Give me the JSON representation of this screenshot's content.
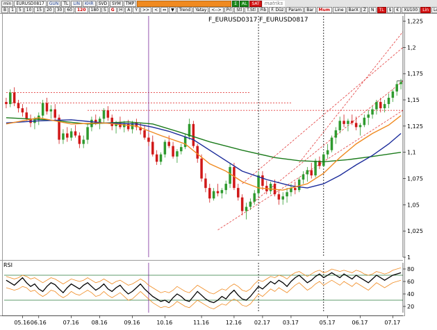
{
  "toolbar": {
    "row1": [
      {
        "label": "min",
        "style": ""
      },
      {
        "label": "EURUSD0817",
        "style": "input"
      },
      {
        "label": "GUN",
        "style": "blue"
      },
      {
        "label": "TL",
        "style": ""
      },
      {
        "label": "LIN",
        "style": "blue"
      },
      {
        "label": "KHR",
        "style": "blue"
      },
      {
        "label": "SVD",
        "style": ""
      },
      {
        "label": "SYM",
        "style": ""
      },
      {
        "label": "TMP",
        "style": ""
      },
      {
        "label": "",
        "style": "orange"
      },
      {
        "label": "Σ",
        "style": "green"
      },
      {
        "label": "AL",
        "style": "green"
      },
      {
        "label": "SAT",
        "style": "red"
      },
      {
        "label": "matriks",
        "style": "brand"
      }
    ],
    "row2": [
      {
        "label": "B",
        "style": ""
      },
      {
        "label": "1",
        "style": ""
      },
      {
        "label": "5",
        "style": ""
      },
      {
        "label": "10",
        "style": ""
      },
      {
        "label": "15",
        "style": ""
      },
      {
        "label": "20",
        "style": ""
      },
      {
        "label": "30",
        "style": ""
      },
      {
        "label": "60",
        "style": ""
      },
      {
        "label": "120",
        "style": "active"
      },
      {
        "label": "180",
        "style": ""
      },
      {
        "label": "S",
        "style": ""
      },
      {
        "label": "G",
        "style": "active"
      },
      {
        "label": "H",
        "style": ""
      },
      {
        "label": "A",
        "style": ""
      },
      {
        "label": "Y",
        "style": ""
      },
      {
        "label": ">>",
        "style": ""
      },
      {
        "label": "<",
        "style": ""
      },
      {
        "label": "⇔",
        "style": ""
      },
      {
        "label": "▼",
        "style": ""
      },
      {
        "label": "Trend",
        "style": ""
      },
      {
        "label": "Yatay",
        "style": ""
      },
      {
        "label": "<-->",
        "style": ""
      },
      {
        "label": "Prl",
        "style": ""
      },
      {
        "label": "Stl",
        "style": ""
      },
      {
        "label": "T.Stl",
        "style": ""
      },
      {
        "label": "Fib",
        "style": ""
      },
      {
        "label": "F. Düz",
        "style": ""
      },
      {
        "label": "Param",
        "style": ""
      },
      {
        "label": "Bar",
        "style": ""
      },
      {
        "label": "Mum",
        "style": "active"
      },
      {
        "label": "Line",
        "style": ""
      },
      {
        "label": "BarX",
        "style": ""
      },
      {
        "label": "Z",
        "style": ""
      },
      {
        "label": "N",
        "style": ""
      },
      {
        "label": "TL",
        "style": "red"
      },
      {
        "label": "$",
        "style": ""
      },
      {
        "label": "€",
        "style": ""
      },
      {
        "label": "XU100",
        "style": ""
      },
      {
        "label": "Lin",
        "style": "red"
      },
      {
        "label": "Log",
        "style": ""
      },
      {
        "label": "Yüz",
        "style": ""
      }
    ]
  },
  "symbols_label": "F_EURUSD0317  F_EURUSD0817",
  "rsi_title": "RSI",
  "price_axis": [
    "1,225",
    "1,2",
    "1,175",
    "1,15",
    "1,125",
    "1,1",
    "1,075",
    "1,05",
    "1,025",
    "1"
  ],
  "rsi_axis": [
    "80",
    "60",
    "40",
    "20"
  ],
  "x_labels": [
    "05.16",
    "06.16",
    "07.16",
    "08.16",
    "09.16",
    "10.16",
    "11.16",
    "12.16",
    "02.17",
    "03.17",
    "05.17",
    "06.17",
    "07.17"
  ],
  "colors": {
    "bull": "#2e9a2e",
    "bear": "#d01818",
    "ma_short": "#f08a20",
    "ma_mid": "#1a2a9a",
    "ma_long": "#1a7a1a",
    "hline": "#e23a3a",
    "rsi": "#000000",
    "rsi_band": "#f08a20",
    "vline_marker": "#7a2a9a",
    "vline_split": "#000000"
  },
  "chart_data": {
    "type": "candlestick",
    "title": "F_EURUSD0317  F_EURUSD0817",
    "x_tick_labels": [
      "05.16",
      "06.16",
      "07.16",
      "08.16",
      "09.16",
      "10.16",
      "11.16",
      "12.16",
      "02.17",
      "03.17",
      "05.17",
      "06.17",
      "07.17"
    ],
    "ylim": [
      1.0,
      1.23
    ],
    "y_ticks": [
      1.225,
      1.2,
      1.175,
      1.15,
      1.125,
      1.1,
      1.075,
      1.05,
      1.025,
      1.0
    ],
    "candles": [
      [
        1.148,
        1.152,
        1.142,
        1.146
      ],
      [
        1.146,
        1.16,
        1.143,
        1.157
      ],
      [
        1.157,
        1.162,
        1.144,
        1.147
      ],
      [
        1.147,
        1.15,
        1.138,
        1.142
      ],
      [
        1.142,
        1.146,
        1.134,
        1.138
      ],
      [
        1.138,
        1.143,
        1.13,
        1.132
      ],
      [
        1.132,
        1.136,
        1.124,
        1.128
      ],
      [
        1.128,
        1.134,
        1.122,
        1.131
      ],
      [
        1.131,
        1.138,
        1.126,
        1.135
      ],
      [
        1.135,
        1.15,
        1.132,
        1.147
      ],
      [
        1.147,
        1.152,
        1.136,
        1.139
      ],
      [
        1.139,
        1.145,
        1.132,
        1.141
      ],
      [
        1.141,
        1.146,
        1.13,
        1.133
      ],
      [
        1.133,
        1.136,
        1.108,
        1.112
      ],
      [
        1.112,
        1.122,
        1.108,
        1.118
      ],
      [
        1.118,
        1.124,
        1.11,
        1.114
      ],
      [
        1.114,
        1.123,
        1.111,
        1.12
      ],
      [
        1.12,
        1.126,
        1.114,
        1.116
      ],
      [
        1.116,
        1.119,
        1.104,
        1.108
      ],
      [
        1.108,
        1.116,
        1.104,
        1.112
      ],
      [
        1.112,
        1.128,
        1.108,
        1.124
      ],
      [
        1.124,
        1.134,
        1.12,
        1.131
      ],
      [
        1.131,
        1.136,
        1.126,
        1.128
      ],
      [
        1.128,
        1.134,
        1.122,
        1.132
      ],
      [
        1.132,
        1.142,
        1.128,
        1.14
      ],
      [
        1.14,
        1.144,
        1.13,
        1.133
      ],
      [
        1.133,
        1.136,
        1.121,
        1.125
      ],
      [
        1.125,
        1.13,
        1.118,
        1.128
      ],
      [
        1.128,
        1.134,
        1.122,
        1.124
      ],
      [
        1.124,
        1.13,
        1.119,
        1.127
      ],
      [
        1.127,
        1.131,
        1.12,
        1.122
      ],
      [
        1.122,
        1.13,
        1.118,
        1.128
      ],
      [
        1.128,
        1.132,
        1.121,
        1.124
      ],
      [
        1.124,
        1.128,
        1.117,
        1.121
      ],
      [
        1.121,
        1.126,
        1.112,
        1.114
      ],
      [
        1.114,
        1.118,
        1.106,
        1.11
      ],
      [
        1.11,
        1.116,
        1.096,
        1.098
      ],
      [
        1.098,
        1.102,
        1.088,
        1.091
      ],
      [
        1.091,
        1.1,
        1.088,
        1.098
      ],
      [
        1.098,
        1.112,
        1.095,
        1.11
      ],
      [
        1.11,
        1.116,
        1.104,
        1.106
      ],
      [
        1.106,
        1.11,
        1.094,
        1.096
      ],
      [
        1.096,
        1.103,
        1.09,
        1.101
      ],
      [
        1.101,
        1.108,
        1.098,
        1.105
      ],
      [
        1.105,
        1.118,
        1.103,
        1.115
      ],
      [
        1.115,
        1.132,
        1.112,
        1.127
      ],
      [
        1.127,
        1.13,
        1.104,
        1.106
      ],
      [
        1.106,
        1.108,
        1.09,
        1.094
      ],
      [
        1.094,
        1.098,
        1.072,
        1.075
      ],
      [
        1.075,
        1.08,
        1.062,
        1.066
      ],
      [
        1.066,
        1.07,
        1.052,
        1.056
      ],
      [
        1.056,
        1.066,
        1.054,
        1.063
      ],
      [
        1.063,
        1.07,
        1.058,
        1.061
      ],
      [
        1.061,
        1.066,
        1.056,
        1.064
      ],
      [
        1.064,
        1.073,
        1.06,
        1.07
      ],
      [
        1.07,
        1.09,
        1.066,
        1.086
      ],
      [
        1.086,
        1.09,
        1.064,
        1.066
      ],
      [
        1.066,
        1.07,
        1.054,
        1.057
      ],
      [
        1.057,
        1.06,
        1.04,
        1.044
      ],
      [
        1.044,
        1.052,
        1.036,
        1.048
      ],
      [
        1.048,
        1.056,
        1.045,
        1.053
      ],
      [
        1.053,
        1.064,
        1.05,
        1.061
      ],
      [
        1.061,
        1.082,
        1.058,
        1.078
      ],
      [
        1.078,
        1.082,
        1.064,
        1.068
      ],
      [
        1.068,
        1.073,
        1.06,
        1.063
      ],
      [
        1.063,
        1.072,
        1.06,
        1.07
      ],
      [
        1.07,
        1.074,
        1.058,
        1.06
      ],
      [
        1.06,
        1.064,
        1.05,
        1.055
      ],
      [
        1.055,
        1.062,
        1.05,
        1.058
      ],
      [
        1.058,
        1.066,
        1.052,
        1.062
      ],
      [
        1.062,
        1.07,
        1.058,
        1.066
      ],
      [
        1.066,
        1.072,
        1.06,
        1.064
      ],
      [
        1.064,
        1.076,
        1.062,
        1.074
      ],
      [
        1.074,
        1.082,
        1.07,
        1.079
      ],
      [
        1.079,
        1.086,
        1.072,
        1.083
      ],
      [
        1.083,
        1.09,
        1.075,
        1.078
      ],
      [
        1.078,
        1.094,
        1.076,
        1.092
      ],
      [
        1.092,
        1.096,
        1.084,
        1.087
      ],
      [
        1.087,
        1.1,
        1.086,
        1.098
      ],
      [
        1.098,
        1.108,
        1.094,
        1.102
      ],
      [
        1.102,
        1.116,
        1.1,
        1.114
      ],
      [
        1.114,
        1.124,
        1.108,
        1.121
      ],
      [
        1.121,
        1.134,
        1.118,
        1.13
      ],
      [
        1.13,
        1.136,
        1.124,
        1.127
      ],
      [
        1.127,
        1.132,
        1.12,
        1.13
      ],
      [
        1.13,
        1.136,
        1.126,
        1.128
      ],
      [
        1.128,
        1.134,
        1.121,
        1.124
      ],
      [
        1.124,
        1.128,
        1.116,
        1.126
      ],
      [
        1.126,
        1.136,
        1.124,
        1.133
      ],
      [
        1.133,
        1.14,
        1.126,
        1.136
      ],
      [
        1.136,
        1.144,
        1.132,
        1.141
      ],
      [
        1.141,
        1.15,
        1.136,
        1.148
      ],
      [
        1.148,
        1.152,
        1.138,
        1.142
      ],
      [
        1.142,
        1.15,
        1.138,
        1.146
      ],
      [
        1.146,
        1.156,
        1.142,
        1.152
      ],
      [
        1.152,
        1.16,
        1.148,
        1.158
      ],
      [
        1.158,
        1.168,
        1.154,
        1.165
      ],
      [
        1.165,
        1.17,
        1.16,
        1.167
      ]
    ],
    "ma_short": [
      [
        0,
        1.127
      ],
      [
        8,
        1.133
      ],
      [
        16,
        1.127
      ],
      [
        24,
        1.128
      ],
      [
        32,
        1.125
      ],
      [
        38,
        1.116
      ],
      [
        44,
        1.108
      ],
      [
        50,
        1.089
      ],
      [
        54,
        1.082
      ],
      [
        58,
        1.072
      ],
      [
        62,
        1.066
      ],
      [
        68,
        1.064
      ],
      [
        74,
        1.07
      ],
      [
        78,
        1.08
      ],
      [
        82,
        1.095
      ],
      [
        86,
        1.108
      ],
      [
        90,
        1.118
      ],
      [
        94,
        1.126
      ],
      [
        97,
        1.135
      ]
    ],
    "ma_mid": [
      [
        0,
        1.128
      ],
      [
        8,
        1.13
      ],
      [
        16,
        1.131
      ],
      [
        24,
        1.128
      ],
      [
        32,
        1.127
      ],
      [
        36,
        1.124
      ],
      [
        40,
        1.12
      ],
      [
        46,
        1.112
      ],
      [
        52,
        1.097
      ],
      [
        58,
        1.082
      ],
      [
        64,
        1.074
      ],
      [
        70,
        1.068
      ],
      [
        74,
        1.066
      ],
      [
        78,
        1.07
      ],
      [
        82,
        1.078
      ],
      [
        86,
        1.088
      ],
      [
        90,
        1.097
      ],
      [
        94,
        1.108
      ],
      [
        97,
        1.118
      ]
    ],
    "ma_long": [
      [
        0,
        1.133
      ],
      [
        10,
        1.131
      ],
      [
        20,
        1.127
      ],
      [
        30,
        1.129
      ],
      [
        36,
        1.127
      ],
      [
        42,
        1.12
      ],
      [
        50,
        1.11
      ],
      [
        58,
        1.102
      ],
      [
        66,
        1.095
      ],
      [
        72,
        1.092
      ],
      [
        78,
        1.091
      ],
      [
        84,
        1.093
      ],
      [
        90,
        1.096
      ],
      [
        97,
        1.1
      ]
    ],
    "horizontal_lines": [
      1.157,
      1.147,
      1.14
    ],
    "channel_lines": [
      [
        [
          52,
          1.026
        ],
        [
          100,
          1.14
        ]
      ],
      [
        [
          60,
          1.05
        ],
        [
          100,
          1.168
        ]
      ],
      [
        [
          58,
          1.07
        ],
        [
          100,
          1.2
        ]
      ],
      [
        [
          72,
          1.09
        ],
        [
          100,
          1.215
        ]
      ]
    ],
    "last_price_line": 1.168
  },
  "rsi_data": {
    "ylim": [
      10,
      90
    ],
    "levels": [
      80,
      60,
      40,
      20
    ],
    "ref_lines": [
      70,
      30
    ],
    "values": [
      62,
      58,
      54,
      60,
      66,
      58,
      52,
      56,
      48,
      44,
      52,
      58,
      55,
      48,
      42,
      50,
      56,
      52,
      48,
      54,
      58,
      52,
      46,
      50,
      56,
      48,
      44,
      50,
      54,
      46,
      40,
      44,
      50,
      56,
      48,
      42,
      36,
      32,
      28,
      30,
      26,
      34,
      40,
      36,
      30,
      28,
      36,
      44,
      38,
      32,
      28,
      26,
      30,
      36,
      32,
      40,
      46,
      38,
      32,
      30,
      36,
      44,
      52,
      48,
      54,
      60,
      56,
      62,
      58,
      52,
      60,
      66,
      70,
      64,
      58,
      62,
      68,
      72,
      66,
      70,
      74,
      70,
      66,
      72,
      68,
      64,
      70,
      66,
      62,
      58,
      64,
      70,
      66,
      62,
      66,
      70,
      72,
      74
    ],
    "upper_band": [
      68,
      66,
      64,
      66,
      70,
      68,
      64,
      66,
      62,
      58,
      62,
      66,
      64,
      60,
      56,
      60,
      64,
      62,
      60,
      62,
      66,
      62,
      58,
      60,
      64,
      60,
      56,
      60,
      62,
      58,
      54,
      56,
      60,
      64,
      60,
      54,
      50,
      46,
      42,
      44,
      42,
      46,
      52,
      48,
      44,
      42,
      48,
      54,
      50,
      46,
      42,
      40,
      44,
      48,
      46,
      52,
      56,
      52,
      46,
      44,
      48,
      56,
      62,
      60,
      64,
      68,
      66,
      70,
      68,
      64,
      70,
      74,
      76,
      72,
      68,
      72,
      76,
      78,
      74,
      76,
      80,
      78,
      76,
      78,
      76,
      74,
      78,
      76,
      72,
      70,
      72,
      76,
      74,
      72,
      74,
      78,
      80,
      82
    ],
    "lower_band": [
      50,
      48,
      46,
      48,
      52,
      50,
      44,
      46,
      40,
      36,
      40,
      46,
      44,
      38,
      34,
      38,
      44,
      40,
      38,
      42,
      46,
      42,
      36,
      38,
      44,
      38,
      34,
      38,
      42,
      36,
      30,
      32,
      38,
      44,
      38,
      32,
      26,
      22,
      18,
      20,
      18,
      22,
      28,
      24,
      20,
      18,
      24,
      30,
      26,
      22,
      18,
      16,
      20,
      24,
      22,
      28,
      32,
      28,
      22,
      20,
      24,
      32,
      40,
      36,
      42,
      48,
      44,
      50,
      46,
      42,
      48,
      54,
      58,
      52,
      46,
      50,
      56,
      60,
      54,
      58,
      62,
      58,
      54,
      60,
      56,
      52,
      58,
      54,
      50,
      46,
      52,
      58,
      54,
      50,
      54,
      58,
      60,
      62
    ]
  }
}
